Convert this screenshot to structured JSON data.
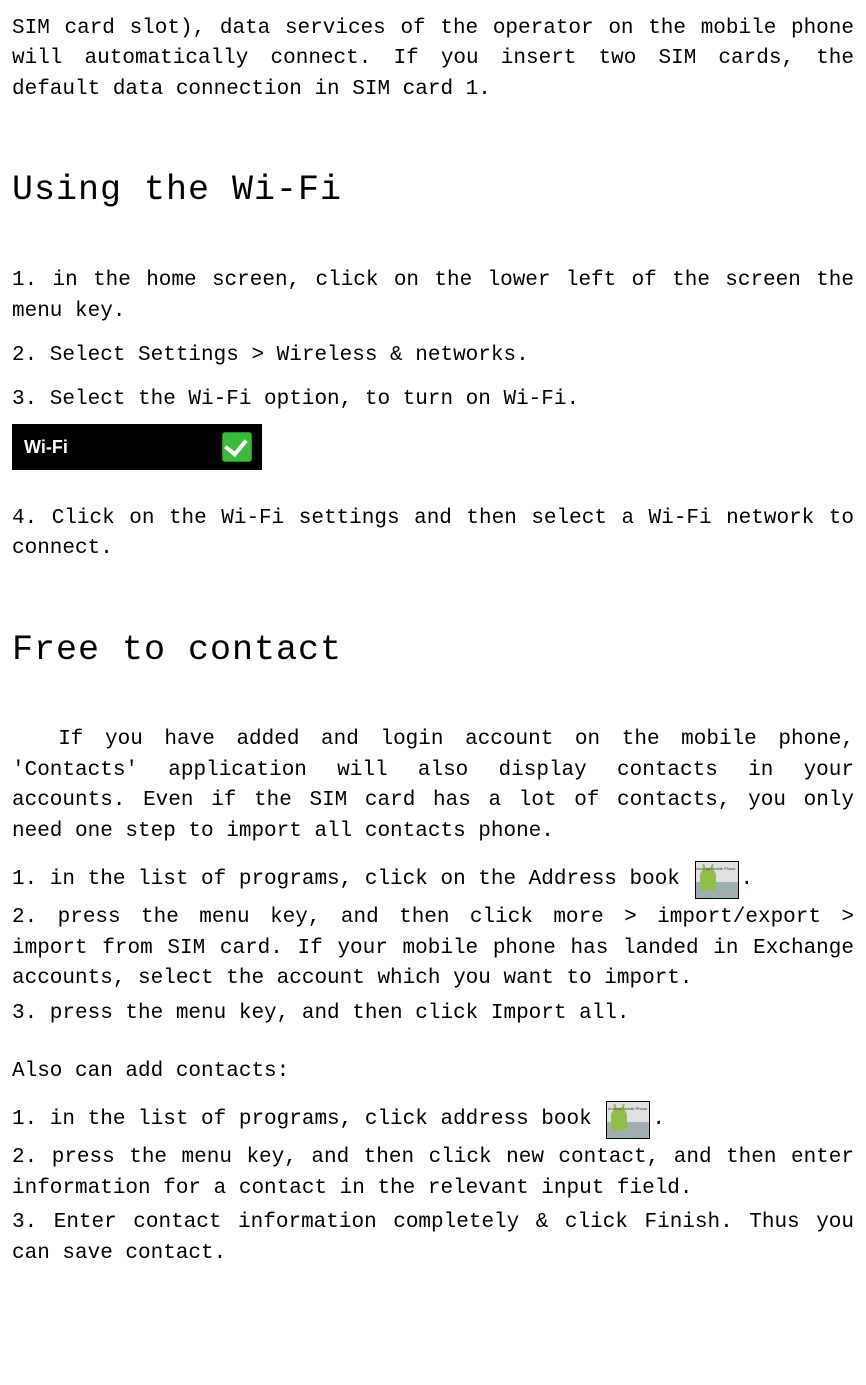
{
  "intro_paragraph": "SIM card slot), data services of the operator on the mobile phone will automatically connect.  If you insert two SIM cards, the default data connection in SIM card 1.",
  "heading_wifi": "Using the Wi-Fi",
  "wifi": {
    "step1": "1. in the home screen, click on the lower left of the screen the menu key.",
    "step2": "2.  Select Settings > Wireless & networks.",
    "step3": "3. Select the Wi-Fi option, to turn on Wi-Fi.",
    "toggle_label": "Wi-Fi",
    "step4": "4. Click on the Wi-Fi settings and then select a Wi-Fi network to connect."
  },
  "heading_contact": "Free to contact",
  "contact_intro": "If you have added and login account on the mobile phone, 'Contacts'  application will also display contacts in your accounts. Even if the SIM card has a lot of contacts, you only need one step to import all contacts phone.",
  "import": {
    "step1_before": "1. in the list of programs, click on the Address book",
    "step1_after": ".",
    "step2": "2. press the menu key, and then click more > import/export > import from SIM card. If your mobile phone has landed in Exchange accounts, select the account which you want to import.",
    "step3": "3. press the menu key, and then click Import all."
  },
  "also_label": "Also can add contacts:",
  "add": {
    "step1_before": "1. in the list of programs, click address book",
    "step1_after": ".",
    "step2": "2. press the menu key, and then click new contact, and then enter information for a contact in the relevant input field.",
    "step3": "3. Enter contact information completely & click Finish. Thus you can save contact."
  },
  "icon_caption": "Android Mobile Phone"
}
